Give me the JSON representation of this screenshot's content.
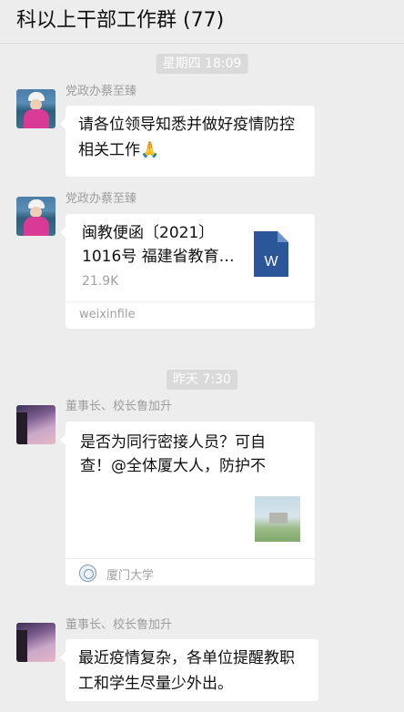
{
  "header": {
    "title": "科以上干部工作群 (77)"
  },
  "timestamps": {
    "t1": "星期四 18:09",
    "t2": "昨天 7:30"
  },
  "messages": [
    {
      "sender": "党政办蔡至臻",
      "avatar_icon": "woman-photo-avatar",
      "text": "请各位领导知悉并做好疫情防控相关工作🙏"
    },
    {
      "sender": "党政办蔡至臻",
      "avatar_icon": "woman-photo-avatar",
      "file": {
        "title": "闽教便函〔2021〕1016号 福建省教育…",
        "size": "21.9K",
        "source": "weixinfile",
        "file_icon": "word-doc-icon",
        "icon_color": "#2b579a"
      }
    },
    {
      "sender": "董事长、校长鲁加升",
      "avatar_icon": "sunset-avatar",
      "link": {
        "title": "是否为同行密接人员？可自查！@全体厦大人，防护不",
        "source": "厦门大学",
        "source_icon": "xmu-logo-icon"
      }
    },
    {
      "sender": "董事长、校长鲁加升",
      "avatar_icon": "sunset-avatar",
      "text": "最近疫情复杂，各单位提醒教职工和学生尽量少外出。"
    }
  ]
}
